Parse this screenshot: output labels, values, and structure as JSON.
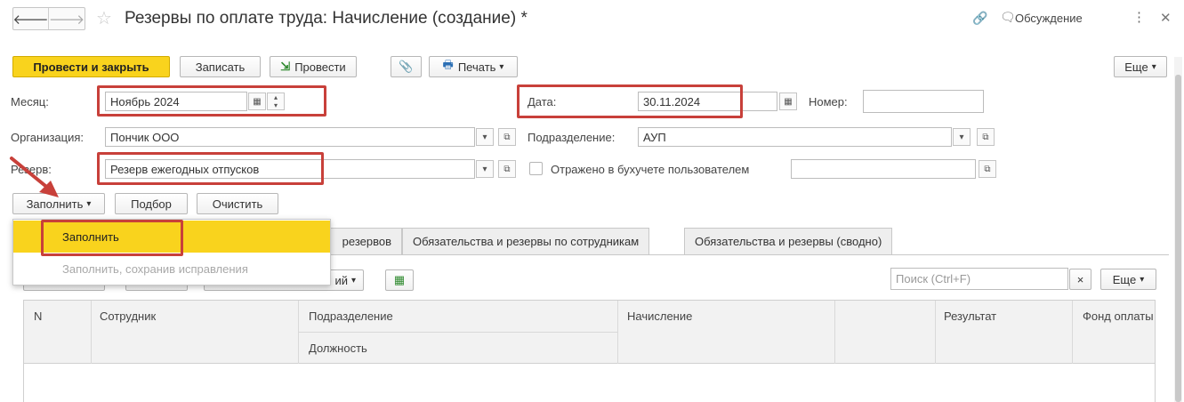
{
  "window": {
    "title": "Резервы по оплате труда: Начисление (создание) *",
    "discussion_label": "Обсуждение",
    "more_glyph": "⋮",
    "close_glyph": "✕",
    "back_glyph": "🡐",
    "forward_glyph": "🡒",
    "star_glyph": "☆",
    "link_glyph": "🔗",
    "chat_glyph": "🗨"
  },
  "toolbar": {
    "post_close": "Провести и закрыть",
    "save": "Записать",
    "post": "Провести",
    "print": "Печать",
    "more": "Еще",
    "dropdown_glyph": "▾",
    "attach_glyph": "📎",
    "post_glyph": "⇲",
    "print_glyph": "🖶"
  },
  "form": {
    "month_label": "Месяц:",
    "month_value": "Ноябрь 2024",
    "date_label": "Дата:",
    "date_value": "30.11.2024",
    "number_label": "Номер:",
    "number_value": "",
    "org_label": "Организация:",
    "org_value": "Пончик ООО",
    "dept_label": "Подразделение:",
    "dept_value": "АУП",
    "reserve_label": "Резерв:",
    "reserve_value": "Резерв ежегодных отпусков",
    "reflected_label": "Отражено в бухучете пользователем",
    "reflected_value": "",
    "calendar_glyph": "▦",
    "open_glyph": "⧉",
    "spin_up": "▴",
    "spin_down": "▾"
  },
  "actions": {
    "fill": "Заполнить",
    "select": "Подбор",
    "clear": "Очистить"
  },
  "fill_menu": {
    "items": [
      "Заполнить",
      "Заполнить, сохранив исправления"
    ]
  },
  "tabs": [
    "резервов",
    "Обязательства и резервы по сотрудникам",
    "Обязательства и резервы (сводно)"
  ],
  "subtoolbar": {
    "partial_label": "ий",
    "search_placeholder": "Поиск (Ctrl+F)",
    "clear_glyph": "×",
    "more": "Еще",
    "table_glyph": "▦"
  },
  "table": {
    "columns": [
      "N",
      "Сотрудник",
      "Подразделение",
      "Должность",
      "Начисление",
      "Результат",
      "Фонд оплаты"
    ]
  },
  "colors": {
    "accent": "#f9d31d",
    "highlight": "#c8403a"
  }
}
